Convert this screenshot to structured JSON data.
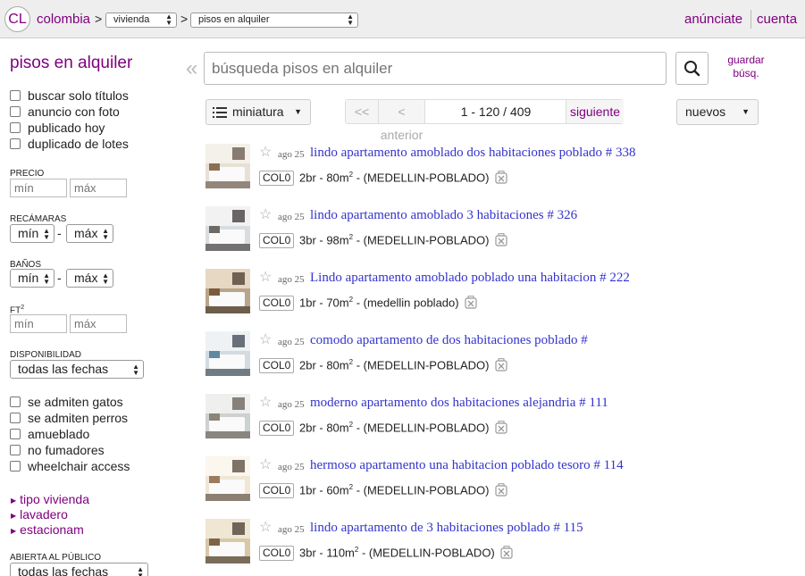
{
  "header": {
    "logo": "CL",
    "area": "colombia",
    "sep1": ">",
    "sep2": ">",
    "category_select": "vivienda",
    "subcategory_select": "pisos en alquiler",
    "post_link": "anúnciate",
    "account_link": "cuenta"
  },
  "sidebar": {
    "title": "pisos en alquiler",
    "top_checks": [
      "buscar solo títulos",
      "anuncio con foto",
      "publicado hoy",
      "duplicado de lotes"
    ],
    "price_label": "PRECIO",
    "min_placeholder": "mín",
    "max_placeholder": "máx",
    "bedrooms_label": "RECÁMARAS",
    "bedrooms_min": "mín",
    "bedrooms_max": "máx",
    "baths_label": "BAÑOS",
    "baths_min": "mín",
    "baths_max": "máx",
    "dash": "-",
    "ft_label": "FT",
    "ft_sup": "2",
    "availability_label": "DISPONIBILIDAD",
    "availability_value": "todas las fechas",
    "feature_checks": [
      "se admiten gatos",
      "se admiten perros",
      "amueblado",
      "no fumadores",
      "wheelchair access"
    ],
    "expanders": [
      "tipo vivienda",
      "lavadero",
      "estacionam"
    ],
    "open_house_label": "ABIERTA AL PÚBLICO",
    "open_house_value": "todas las fechas"
  },
  "search": {
    "placeholder": "búsqueda pisos en alquiler",
    "save_line1": "guardar",
    "save_line2": "búsq."
  },
  "toolbar": {
    "view_mode": "miniatura",
    "first": "<<",
    "prev": "< anterior",
    "range": "1 - 120 / 409",
    "next": "siguiente",
    "sort": "nuevos"
  },
  "results": [
    {
      "date": "ago 25",
      "title": "lindo apartamento amoblado dos habitaciones poblado # 338",
      "tag": "COL0",
      "size": "2br - 80m",
      "sup": "2",
      "location": " - (MEDELLIN-POBLADO)"
    },
    {
      "date": "ago 25",
      "title": "lindo apartamento amoblado 3 habitaciones # 326",
      "tag": "COL0",
      "size": "3br - 98m",
      "sup": "2",
      "location": " - (MEDELLIN-POBLADO)"
    },
    {
      "date": "ago 25",
      "title": "Lindo apartamento amoblado poblado una habitacion # 222",
      "tag": "COL0",
      "size": "1br - 70m",
      "sup": "2",
      "location": " - (medellin poblado)"
    },
    {
      "date": "ago 25",
      "title": "comodo apartamento de dos habitaciones poblado #",
      "tag": "COL0",
      "size": "2br - 80m",
      "sup": "2",
      "location": " - (MEDELLIN-POBLADO)"
    },
    {
      "date": "ago 25",
      "title": "moderno apartamento dos habitaciones alejandria # 111",
      "tag": "COL0",
      "size": "2br - 80m",
      "sup": "2",
      "location": " - (MEDELLIN-POBLADO)"
    },
    {
      "date": "ago 25",
      "title": "hermoso apartamento una habitacion poblado tesoro # 114",
      "tag": "COL0",
      "size": "1br - 60m",
      "sup": "2",
      "location": " - (MEDELLIN-POBLADO)"
    },
    {
      "date": "ago 25",
      "title": "lindo apartamento de 3 habitaciones poblado # 115",
      "tag": "COL0",
      "size": "3br - 110m",
      "sup": "2",
      "location": " - (MEDELLIN-POBLADO)"
    }
  ],
  "colors": {
    "visited_link": "#800080",
    "result_link": "#3333cc",
    "header_bg": "#eeeeee"
  }
}
